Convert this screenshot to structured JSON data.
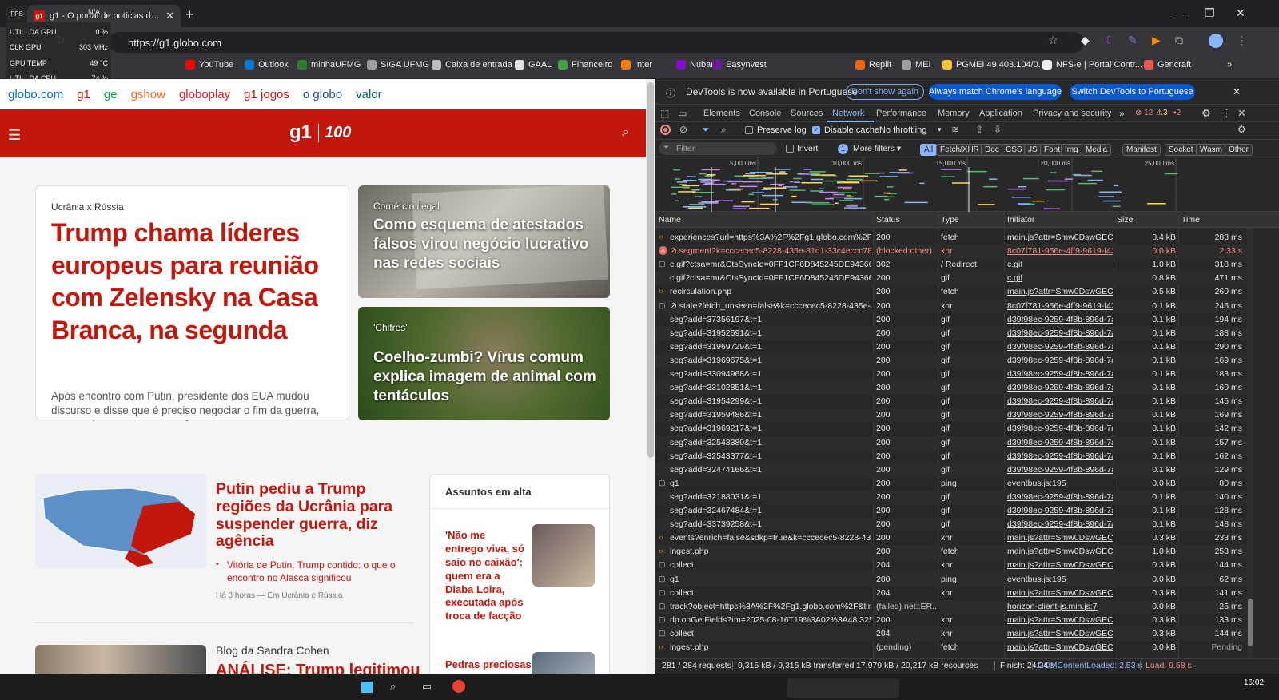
{
  "browser": {
    "tab_title": "g1 - O portal de notícias da Glo",
    "favicon_text": "g1",
    "url": "https://g1.globo.com",
    "bookmarks": [
      {
        "label": "YouTube",
        "color": "#ff0000"
      },
      {
        "label": "Outlook",
        "color": "#0078d4"
      },
      {
        "label": "minhaUFMG",
        "color": "#2e7d32"
      },
      {
        "label": "SIGA UFMG",
        "color": "#9e9e9e"
      },
      {
        "label": "Caixa de entrada",
        "color": "#bdbdbd"
      },
      {
        "label": "GAAL",
        "color": "#e0e0e0"
      },
      {
        "label": "Financeiro",
        "color": "#43a047"
      },
      {
        "label": "Inter",
        "color": "#ff7a00"
      },
      {
        "label": "Nubank",
        "color": "#820ad1"
      },
      {
        "label": "Easynvest",
        "color": "#6a1b9a"
      },
      {
        "label": "Replit",
        "color": "#f26207"
      },
      {
        "label": "MEI",
        "color": "#9e9e9e"
      },
      {
        "label": "PGMEI 49.403.104/0...",
        "color": "#fbc02d"
      },
      {
        "label": "NFS-e | Portal Contr...",
        "color": "#eeeeee"
      },
      {
        "label": "Gencraft",
        "color": "#ef5350"
      }
    ]
  },
  "overlay": {
    "fps_label": "FPS",
    "fps_value": "N/A",
    "rows": [
      {
        "label": "UTIL. DA GPU",
        "value": "0 %"
      },
      {
        "label": "CLK GPU",
        "value": "303 MHz"
      },
      {
        "label": "GPU TEMP",
        "value": "49 °C"
      },
      {
        "label": "UTIL. DA CPU",
        "value": "74 %"
      }
    ]
  },
  "site": {
    "nav": [
      {
        "label": "globo.com",
        "color": "#0669de"
      },
      {
        "label": "g1",
        "color": "#c4170c"
      },
      {
        "label": "ge",
        "color": "#06aa48"
      },
      {
        "label": "gshow",
        "color": "#f26a21"
      },
      {
        "label": "globoplay",
        "color": "#e5162b"
      },
      {
        "label": "g1 jogos",
        "color": "#c4170c"
      },
      {
        "label": "o globo",
        "color": "#1e4d8c"
      },
      {
        "label": "valor",
        "color": "#00665e"
      }
    ],
    "logo": "g1",
    "logo_badge": "100",
    "main": {
      "kicker": "Ucrânia x Rússia",
      "headline": "Trump chama líderes europeus para reunião com Zelensky na Casa Branca, na segunda",
      "summary": "Após encontro com Putin, presidente dos EUA mudou discurso e disse que é preciso negociar o fim da guerra, em vez de um mero cessar-fogo"
    },
    "card1": {
      "kicker": "Comércio ilegal",
      "title": "Como esquema de atestados falsos virou negócio lucrativo nas redes sociais"
    },
    "card2": {
      "kicker": "'Chifres'",
      "title": "Coelho-zumbi? Vírus comum explica imagem de animal com tentáculos"
    },
    "story": {
      "headline": "Putin pediu a Trump regiões da Ucrânia para suspender guerra, diz agência",
      "related": "Vitória de Putin, Trump contido: o que o encontro no Alasca significou",
      "meta": "Há 3 horas — Em Ucrânia e Rússia"
    },
    "trending": {
      "title": "Assuntos em alta",
      "item1": "'Não me entrego viva, só saio no caixão': quem era a Diaba Loira, executada após troca de facção",
      "item2": "Pedras preciosas"
    },
    "blog": {
      "name": "Blog da Sandra Cohen",
      "headline": "ANÁLISE: Trump legitimou"
    }
  },
  "devtools": {
    "infobar": {
      "text": "DevTools is now available in Portuguese",
      "btn1": "Don't show again",
      "btn2": "Always match Chrome's language",
      "btn3": "Switch DevTools to Portuguese"
    },
    "tabs": [
      "Elements",
      "Console",
      "Sources",
      "Network",
      "Performance",
      "Memory",
      "Application",
      "Privacy and security"
    ],
    "active_tab": "Network",
    "errors": "12",
    "warnings": "3",
    "issues": "2",
    "toolbar": {
      "preserve_log": "Preserve log",
      "disable_cache": "Disable cache",
      "throttling": "No throttling"
    },
    "filter": {
      "placeholder": "Filter",
      "invert": "Invert",
      "more_filters": "More filters",
      "count": "1",
      "types": [
        "All",
        "Fetch/XHR",
        "Doc",
        "CSS",
        "JS",
        "Font",
        "Img",
        "Media",
        "Manifest",
        "Socket",
        "Wasm",
        "Other"
      ]
    },
    "timeline_ticks": [
      "5,000 ms",
      "10,000 ms",
      "15,000 ms",
      "20,000 ms",
      "25,000 ms"
    ],
    "columns": [
      "Name",
      "Status",
      "Type",
      "Initiator",
      "Size",
      "Time"
    ],
    "rows": [
      {
        "name": "experiences?url=https%3A%2F%2Fg1.globo.com%2F&cl...",
        "status": "200",
        "type": "fetch",
        "initiator": "main.js?attr=Smw0DswGECe3c",
        "size": "0.4 kB",
        "time": "283 ms",
        "icon": "xhr"
      },
      {
        "name": "⊘ segment?k=cccecec5-8228-435e-81d1-33c4eccc78e6",
        "status": "(blocked:other)",
        "type": "xhr",
        "initiator": "8c07f781-956e-4ff9-9619-f437",
        "size": "0.0 kB",
        "time": "2.33 s",
        "icon": "err"
      },
      {
        "name": "c.gif?ctsa=mr&CtsSyncId=0FF1CF6D845245DE94366694...",
        "status": "302",
        "type": "/ Redirect",
        "initiator": "c.gif",
        "size": "1.0 kB",
        "time": "318 ms",
        "icon": "doc"
      },
      {
        "name": "c.gif?ctsa=mr&CtsSyncId=0FF1CF6D845245DE94366694...",
        "status": "200",
        "type": "gif",
        "initiator": "c.gif",
        "size": "0.8 kB",
        "time": "471 ms",
        "icon": "none"
      },
      {
        "name": "recirculation.php",
        "status": "200",
        "type": "fetch",
        "initiator": "main.js?attr=Smw0DswGECe3c",
        "size": "0.5 kB",
        "time": "260 ms",
        "icon": "xhr"
      },
      {
        "name": "⊘ state?fetch_unseen=false&k=cccecec5-8228-435e-81...",
        "status": "200",
        "type": "xhr",
        "initiator": "8c07f781-956e-4ff9-9619-f437",
        "size": "0.1 kB",
        "time": "245 ms",
        "icon": "doc"
      },
      {
        "name": "seg?add=37356197&t=1",
        "status": "200",
        "type": "gif",
        "initiator": "d39f98ec-9259-4f8b-896d-7ab",
        "size": "0.1 kB",
        "time": "194 ms",
        "icon": "none"
      },
      {
        "name": "seg?add=31952691&t=1",
        "status": "200",
        "type": "gif",
        "initiator": "d39f98ec-9259-4f8b-896d-7ab",
        "size": "0.1 kB",
        "time": "183 ms",
        "icon": "none"
      },
      {
        "name": "seg?add=31969729&t=1",
        "status": "200",
        "type": "gif",
        "initiator": "d39f98ec-9259-4f8b-896d-7ab",
        "size": "0.1 kB",
        "time": "290 ms",
        "icon": "none"
      },
      {
        "name": "seg?add=31969675&t=1",
        "status": "200",
        "type": "gif",
        "initiator": "d39f98ec-9259-4f8b-896d-7ab",
        "size": "0.1 kB",
        "time": "169 ms",
        "icon": "none"
      },
      {
        "name": "seg?add=33094968&t=1",
        "status": "200",
        "type": "gif",
        "initiator": "d39f98ec-9259-4f8b-896d-7ab",
        "size": "0.1 kB",
        "time": "183 ms",
        "icon": "none"
      },
      {
        "name": "seg?add=33102851&t=1",
        "status": "200",
        "type": "gif",
        "initiator": "d39f98ec-9259-4f8b-896d-7ab",
        "size": "0.1 kB",
        "time": "160 ms",
        "icon": "none"
      },
      {
        "name": "seg?add=31954299&t=1",
        "status": "200",
        "type": "gif",
        "initiator": "d39f98ec-9259-4f8b-896d-7ab",
        "size": "0.1 kB",
        "time": "145 ms",
        "icon": "none"
      },
      {
        "name": "seg?add=31959486&t=1",
        "status": "200",
        "type": "gif",
        "initiator": "d39f98ec-9259-4f8b-896d-7ab",
        "size": "0.1 kB",
        "time": "169 ms",
        "icon": "none"
      },
      {
        "name": "seg?add=31969217&t=1",
        "status": "200",
        "type": "gif",
        "initiator": "d39f98ec-9259-4f8b-896d-7ab",
        "size": "0.1 kB",
        "time": "142 ms",
        "icon": "none"
      },
      {
        "name": "seg?add=32543380&t=1",
        "status": "200",
        "type": "gif",
        "initiator": "d39f98ec-9259-4f8b-896d-7ab",
        "size": "0.1 kB",
        "time": "157 ms",
        "icon": "none"
      },
      {
        "name": "seg?add=32543377&t=1",
        "status": "200",
        "type": "gif",
        "initiator": "d39f98ec-9259-4f8b-896d-7ab",
        "size": "0.1 kB",
        "time": "162 ms",
        "icon": "none"
      },
      {
        "name": "seg?add=32474166&t=1",
        "status": "200",
        "type": "gif",
        "initiator": "d39f98ec-9259-4f8b-896d-7ab",
        "size": "0.1 kB",
        "time": "129 ms",
        "icon": "none"
      },
      {
        "name": "g1",
        "status": "200",
        "type": "ping",
        "initiator": "eventbus.js:195",
        "size": "0.0 kB",
        "time": "80 ms",
        "icon": "doc"
      },
      {
        "name": "seg?add=32188031&t=1",
        "status": "200",
        "type": "gif",
        "initiator": "d39f98ec-9259-4f8b-896d-7ab",
        "size": "0.1 kB",
        "time": "140 ms",
        "icon": "none"
      },
      {
        "name": "seg?add=32467484&t=1",
        "status": "200",
        "type": "gif",
        "initiator": "d39f98ec-9259-4f8b-896d-7ab",
        "size": "0.1 kB",
        "time": "128 ms",
        "icon": "none"
      },
      {
        "name": "seg?add=33739258&t=1",
        "status": "200",
        "type": "gif",
        "initiator": "d39f98ec-9259-4f8b-896d-7ab",
        "size": "0.1 kB",
        "time": "148 ms",
        "icon": "none"
      },
      {
        "name": "events?enrich=false&sdkp=true&k=cccecec5-8228-435...",
        "status": "200",
        "type": "xhr",
        "initiator": "main.js?attr=Smw0DswGECe3c",
        "size": "0.3 kB",
        "time": "233 ms",
        "icon": "xhr"
      },
      {
        "name": "ingest.php",
        "status": "200",
        "type": "fetch",
        "initiator": "main.js?attr=Smw0DswGECe3c",
        "size": "1.0 kB",
        "time": "253 ms",
        "icon": "xhr"
      },
      {
        "name": "collect",
        "status": "204",
        "type": "xhr",
        "initiator": "main.js?attr=Smw0DswGECe3c",
        "size": "0.3 kB",
        "time": "144 ms",
        "icon": "doc"
      },
      {
        "name": "g1",
        "status": "200",
        "type": "ping",
        "initiator": "eventbus.js:195",
        "size": "0.0 kB",
        "time": "62 ms",
        "icon": "doc"
      },
      {
        "name": "collect",
        "status": "204",
        "type": "xhr",
        "initiator": "main.js?attr=Smw0DswGECe3c",
        "size": "0.3 kB",
        "time": "141 ms",
        "icon": "doc"
      },
      {
        "name": "track?object=https%3A%2F%2Fg1.globo.com%2F&time...",
        "status": "(failed) net::ER...",
        "type": "",
        "initiator": "horizon-client-js.min.js:7",
        "size": "0.0 kB",
        "time": "25 ms",
        "icon": "doc"
      },
      {
        "name": "dp.onGetFields?tm=2025-08-16T19%3A02%3A48.325Z",
        "status": "200",
        "type": "xhr",
        "initiator": "main.js?attr=Smw0DswGECe3c",
        "size": "0.3 kB",
        "time": "133 ms",
        "icon": "doc"
      },
      {
        "name": "collect",
        "status": "204",
        "type": "xhr",
        "initiator": "main.js?attr=Smw0DswGECe3c",
        "size": "0.3 kB",
        "time": "144 ms",
        "icon": "doc"
      },
      {
        "name": "ingest.php",
        "status": "(pending)",
        "type": "fetch",
        "initiator": "main.js?attr=Smw0DswGECe3c",
        "size": "0.0 kB",
        "time": "Pending",
        "icon": "xhr"
      }
    ],
    "status": {
      "requests": "281 / 284 requests",
      "transferred": "9,315 kB / 9,315 kB transferred",
      "resources": "17,979 kB / 20,217 kB resources",
      "finish": "Finish: 24.24 s",
      "dcl": "DOMContentLoaded: 2.53 s",
      "load": "Load: 9.58 s"
    }
  },
  "taskbar": {
    "clock": "16:02"
  }
}
